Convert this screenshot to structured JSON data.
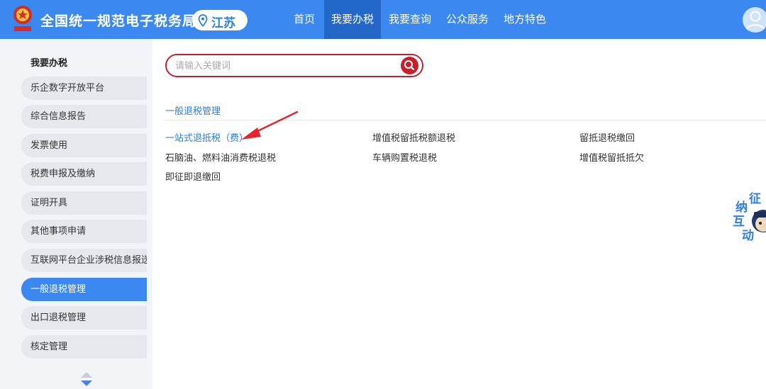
{
  "header": {
    "site_title": "全国统一规范电子税务局",
    "region": "江苏",
    "nav": [
      {
        "label": "首页",
        "active": false
      },
      {
        "label": "我要办税",
        "active": true
      },
      {
        "label": "我要查询",
        "active": false
      },
      {
        "label": "公众服务",
        "active": false
      },
      {
        "label": "地方特色",
        "active": false
      }
    ]
  },
  "sidebar": {
    "title": "我要办税",
    "items": [
      {
        "label": "乐企数字开放平台",
        "active": false
      },
      {
        "label": "综合信息报告",
        "active": false
      },
      {
        "label": "发票使用",
        "active": false
      },
      {
        "label": "税费申报及缴纳",
        "active": false
      },
      {
        "label": "证明开具",
        "active": false
      },
      {
        "label": "其他事项申请",
        "active": false
      },
      {
        "label": "互联网平台企业涉税信息报送",
        "active": false
      },
      {
        "label": "一般退税管理",
        "active": true
      },
      {
        "label": "出口退税管理",
        "active": false
      },
      {
        "label": "核定管理",
        "active": false
      }
    ]
  },
  "search": {
    "placeholder": "请输入关键词",
    "value": ""
  },
  "section": {
    "title": "一般退税管理",
    "links": [
      {
        "label": "一站式退抵税（费）",
        "highlight": true
      },
      {
        "label": "增值税留抵税额退税",
        "highlight": false
      },
      {
        "label": "留抵退税缴回",
        "highlight": false
      },
      {
        "label": "石脑油、燃料油消费税退税",
        "highlight": false
      },
      {
        "label": "车辆购置税退税",
        "highlight": false
      },
      {
        "label": "增值税留抵抵欠",
        "highlight": false
      },
      {
        "label": "即征即退缴回",
        "highlight": false
      }
    ]
  },
  "widget": {
    "chars": [
      "征",
      "纳",
      "互",
      "动"
    ]
  },
  "colors": {
    "header_blue": "#3a88f0",
    "nav_active": "#2367c8",
    "search_red": "#c8202a",
    "link_blue": "#2a7de1",
    "annotation_red": "#e8232b"
  },
  "icons": [
    "national-emblem-icon",
    "location-pin-icon",
    "user-avatar-icon",
    "search-icon",
    "scroll-arrows-icon",
    "annotation-arrow-icon"
  ]
}
